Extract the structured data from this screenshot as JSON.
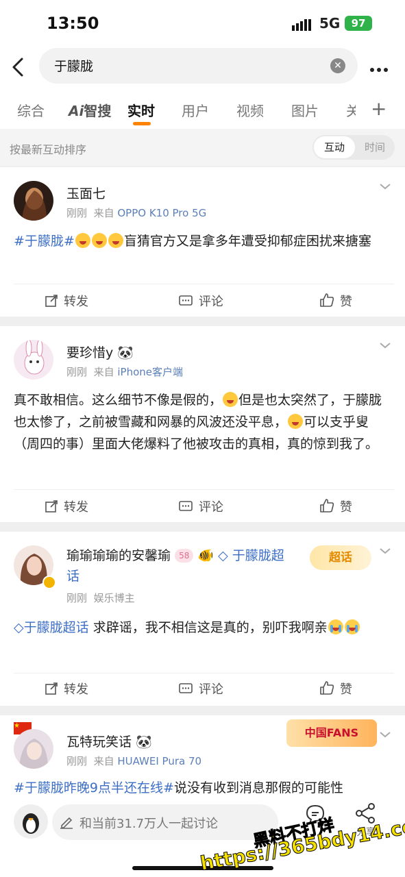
{
  "status": {
    "time": "13:50",
    "network": "5G",
    "battery": "97"
  },
  "search": {
    "query": "于朦胧"
  },
  "tabs": [
    {
      "label": "综合"
    },
    {
      "label": "Ai",
      "suffix": "智搜"
    },
    {
      "label": "实时"
    },
    {
      "label": "用户"
    },
    {
      "label": "视频"
    },
    {
      "label": "图片"
    },
    {
      "label": "关"
    }
  ],
  "sort": {
    "label": "按最新互动排序",
    "opt_active": "互动",
    "opt_inactive": "时间"
  },
  "actions": {
    "repost": "转发",
    "comment": "评论",
    "like": "赞"
  },
  "posts": [
    {
      "name": "玉面七",
      "time": "刚刚",
      "from": "来自",
      "source": "OPPO K10 Pro 5G",
      "tag": "#于朦胧#",
      "text": "盲猜官方又是拿多年遭受抑郁症困扰来搪塞"
    },
    {
      "name": "要珍惜y",
      "time": "刚刚",
      "from": "来自",
      "source": "iPhone客户端",
      "text1": "真不敢相信。这么细节不像是假的，",
      "text2": "但是也太突然了，于朦胧也太惨了，之前被雪藏和网暴的风波还没平息，",
      "text3": "可以支乎叟（周四的事）里面大佬爆料了他被攻击的真相，真的惊到我了。"
    },
    {
      "name": "瑜瑜瑜瑜的安馨瑜",
      "badge": "58",
      "tag_inline": "于朦胧超话",
      "time": "刚刚",
      "role": "娱乐博主",
      "super": "超话",
      "tag": "于朦胧超话",
      "text": "求辟谣，我不相信这是真的，别吓我啊亲"
    },
    {
      "name": "瓦特玩笑话",
      "time": "刚刚",
      "from": "来自",
      "source": "HUAWEI Pura 70",
      "fans": "中国FANS",
      "tag": "#于朦胧昨晚9点半还在线#",
      "text": "说没有收到消息那假的可能性"
    }
  ],
  "bottom": {
    "placeholder": "和当前31.7万人一起讨论",
    "share": "分享"
  },
  "watermark": {
    "line1": "黑料不打烊",
    "line2": "https://365bdy14.com"
  }
}
